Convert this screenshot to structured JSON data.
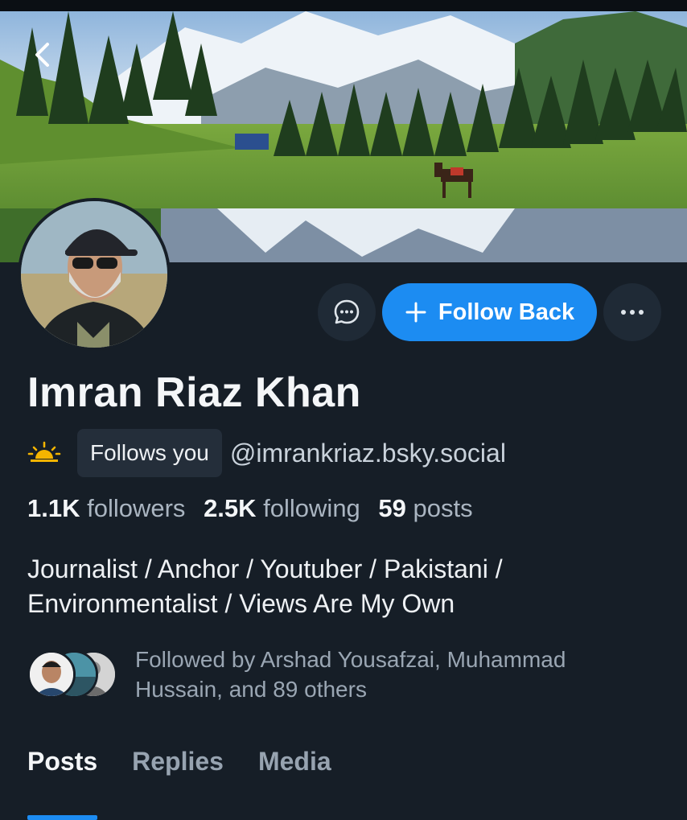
{
  "profile": {
    "name": "Imran Riaz Khan",
    "follows_badge": "Follows you",
    "handle": "@imrankriaz.bsky.social",
    "stats": {
      "followers_count": "1.1K",
      "followers_label": "followers",
      "following_count": "2.5K",
      "following_label": "following",
      "posts_count": "59",
      "posts_label": "posts"
    },
    "bio_line1": "Journalist / Anchor / Youtuber / Pakistani /",
    "bio_line2": "Environmentalist / Views Are My Own",
    "followed_by_line1": "Followed by Arshad Yousafzai, Muhammad",
    "followed_by_line2": "Hussain, and 89 others"
  },
  "actions": {
    "follow_back_label": "Follow Back"
  },
  "tabs": [
    {
      "label": "Posts",
      "active": true
    },
    {
      "label": "Replies",
      "active": false
    },
    {
      "label": "Media",
      "active": false
    }
  ],
  "icons": {
    "back": "chevron-left-icon",
    "message": "chat-bubble-icon",
    "follow": "plus-icon",
    "more": "ellipsis-icon",
    "handle_emoji": "sunrise-icon"
  },
  "colors": {
    "background": "#161e27",
    "accent": "#1c8cf2",
    "button_secondary": "#1f2a36",
    "muted_text": "#9aa6b3"
  }
}
